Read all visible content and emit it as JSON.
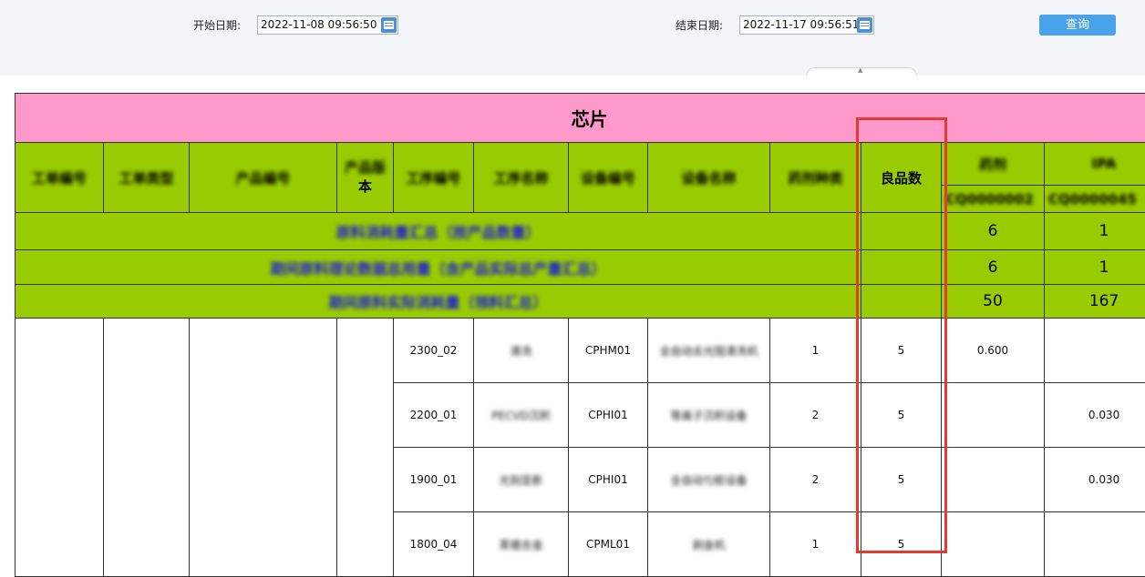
{
  "filters": {
    "start_label": "开始日期:",
    "start_value": "2022-11-08 09:56:50",
    "end_label": "结束日期:",
    "end_value": "2022-11-17 09:56:51",
    "query_button": "查询"
  },
  "report": {
    "title": "芯片",
    "headers": {
      "c1": "工单编号",
      "c2": "工单类型",
      "c3": "产品编号",
      "c4a": "产品版",
      "c4b": "本",
      "c5": "工序编号",
      "c6": "工序名称",
      "c7": "设备编号",
      "c8": "设备名称",
      "c9": "药剂种类",
      "good_qty": "良品数",
      "m1_name": "药剂",
      "m1_code": "CQ0000002",
      "m2_name": "IPA",
      "m2_code": "CQ0000045"
    },
    "summary": [
      {
        "label": "原料消耗量汇总（按产品数量）",
        "m1": "6",
        "m2": "1"
      },
      {
        "label": "期间原料理论数据总用量（含产品实际总产量汇总）",
        "m1": "6",
        "m2": "1"
      },
      {
        "label": "期间原料实际消耗量（领料汇总）",
        "m1": "50",
        "m2": "167"
      }
    ],
    "rows": [
      {
        "step": "2300_02",
        "step_name": "清洗",
        "eq": "CPHM01",
        "eq_name": "全自动去光阻清洗机",
        "kind": "1",
        "good": "5",
        "m1": "0.600",
        "m2": ""
      },
      {
        "step": "2200_01",
        "step_name": "PECVD沉积",
        "eq": "CPHI01",
        "eq_name": "等离子沉积设备",
        "kind": "2",
        "good": "5",
        "m1": "",
        "m2": "0.030"
      },
      {
        "step": "1900_01",
        "step_name": "光刻显影",
        "eq": "CPHI01",
        "eq_name": "全自动匀胶设备",
        "kind": "2",
        "good": "5",
        "m1": "",
        "m2": "0.030"
      },
      {
        "step": "1800_04",
        "step_name": "蒸镀合金",
        "eq": "CPML01",
        "eq_name": "剥金机",
        "kind": "1",
        "good": "5",
        "m1": "",
        "m2": ""
      }
    ]
  }
}
